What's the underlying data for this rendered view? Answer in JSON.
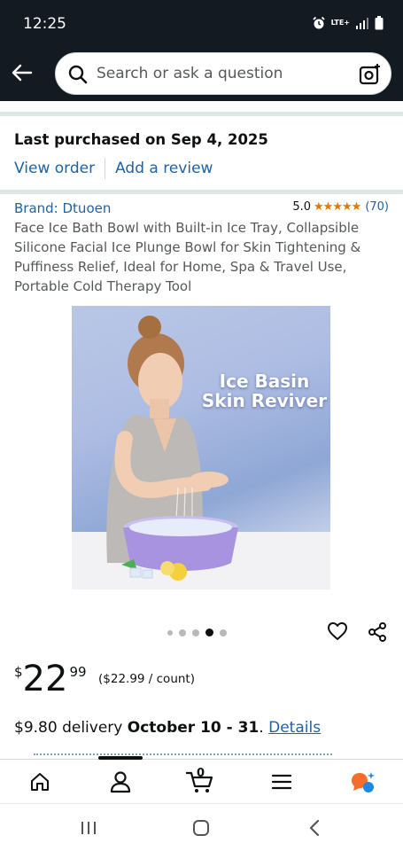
{
  "status_bar": {
    "time": "12:25",
    "network": "LTE+"
  },
  "search": {
    "placeholder": "Search or ask a question",
    "value": ""
  },
  "order": {
    "last_purchased": "Last purchased on Sep 4, 2025",
    "view_order_label": "View order",
    "add_review_label": "Add a review"
  },
  "product": {
    "brand": "Brand: Dtuoen",
    "rating_value": "5.0",
    "stars": "★★★★★",
    "rating_count": "(70)",
    "title": "Face Ice Bath Bowl with Built-in Ice Tray, Collapsible Silicone Facial Ice Plunge Bowl for Skin Tightening & Puffiness Relief, Ideal for Home, Spa & Travel Use, Portable Cold Therapy Tool",
    "image_text_line1": "Ice Basin",
    "image_text_line2": "Skin Reviver",
    "image_count": 5,
    "active_image_index": 3
  },
  "price": {
    "symbol": "$",
    "whole": "22",
    "fraction": "99",
    "unit_price": "($22.99 / count)"
  },
  "delivery": {
    "prefix": "$9.80 delivery ",
    "dates": "October 10 - 31",
    "suffix": ". ",
    "details_label": "Details"
  },
  "cart": {
    "count": "0"
  },
  "colors": {
    "header_bg": "#131a22",
    "link": "#2162a1",
    "star": "#e77600",
    "text": "#0f1111",
    "secondary_text": "#565959",
    "divider": "#dfe6e6"
  },
  "icons": {
    "back": "arrow-left-icon",
    "search": "search-icon",
    "lens": "camera-lens-icon",
    "heart": "heart-icon",
    "share": "share-icon",
    "home": "home-icon",
    "account": "account-icon",
    "cart": "cart-icon",
    "menu": "menu-icon",
    "rufus": "rufus-ai-icon"
  }
}
